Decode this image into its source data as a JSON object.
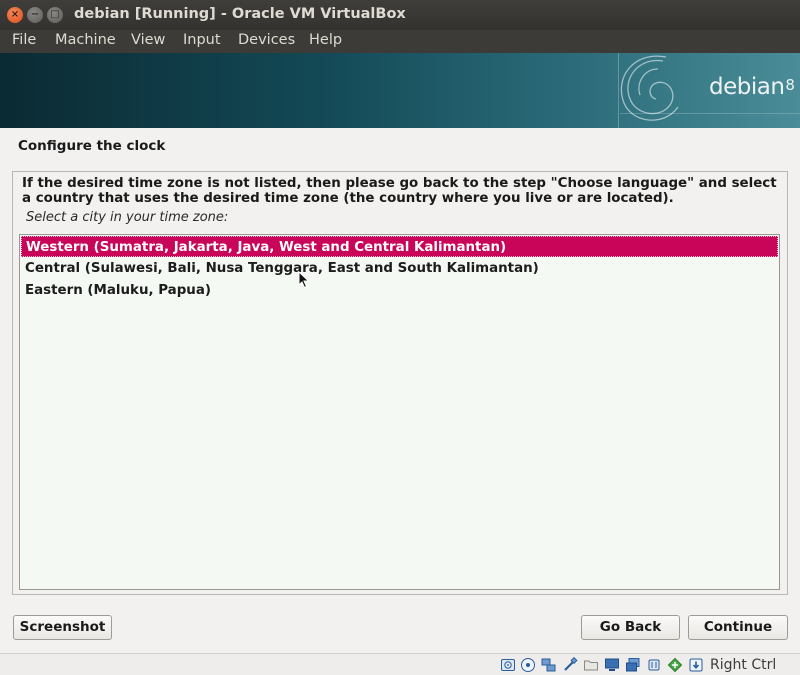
{
  "window": {
    "title": "debian [Running] - Oracle VM VirtualBox",
    "controls": {
      "close": "×",
      "minimize": "−",
      "maximize": "□"
    }
  },
  "menu": [
    "File",
    "Machine",
    "View",
    "Input",
    "Devices",
    "Help"
  ],
  "banner": {
    "brand": "debian",
    "version": "8"
  },
  "installer": {
    "heading": "Configure the clock",
    "description": "If the desired time zone is not listed, then please go back to the step \"Choose language\" and select a country that uses the desired time zone (the country where you live or are located).",
    "prompt": "Select a city in your time zone:",
    "options": [
      "Western (Sumatra, Jakarta, Java, West and Central Kalimantan)",
      "Central (Sulawesi, Bali, Nusa Tenggara, East and South Kalimantan)",
      "Eastern (Maluku, Papua)"
    ],
    "selected_option": "Western (Sumatra, Jakarta, Java, West and Central Kalimantan)"
  },
  "buttons": {
    "screenshot": "Screenshot",
    "go_back": "Go Back",
    "continue": "Continue"
  },
  "statusbar": {
    "icons": [
      "hard-disk-icon",
      "optical-drive-icon",
      "network-icon",
      "usb-icon",
      "shared-folders-icon",
      "display-icon",
      "video-capture-icon",
      "cpu-icon",
      "mouse-integration-icon",
      "keyboard-capture-icon"
    ],
    "host_key": "Right Ctrl"
  },
  "colors": {
    "selection": "#c90559",
    "titlebar": "#3c3b37",
    "banner": "#134956",
    "close_button": "#df4b16"
  }
}
